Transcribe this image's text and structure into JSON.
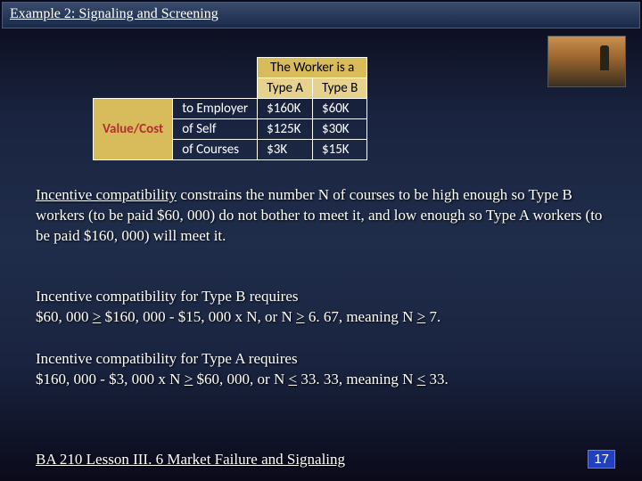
{
  "title": "Example 2: Signaling and Screening",
  "table": {
    "header_main": "The Worker is a",
    "col_a": "Type A",
    "col_b": "Type B",
    "rowgroup": "Value/Cost",
    "rows": [
      {
        "label": "to Employer",
        "a": "$160K",
        "b": "$60K"
      },
      {
        "label": "of Self",
        "a": "$125K",
        "b": "$30K"
      },
      {
        "label": "of Courses",
        "a": "$3K",
        "b": "$15K"
      }
    ]
  },
  "para1_lead": "Incentive compatibility",
  "para1_rest": " constrains the number N of courses to be high enough so Type B workers (to be paid $60, 000) do not bother to meet it, and low enough so Type A workers (to be paid $160, 000) will meet it.",
  "para2_l1": "Incentive compatibility for Type B requires",
  "para2_l2a": "$60, 000 ",
  "para2_l2b": ">",
  "para2_l2c": " $160, 000 - $15, 000 x N, or N ",
  "para2_l2d": ">",
  "para2_l2e": " 6. 67, meaning N ",
  "para2_l2f": ">",
  "para2_l2g": " 7.",
  "para3_l1": "Incentive compatibility for Type A requires",
  "para3_l2a": "$160, 000 - $3, 000 x N ",
  "para3_l2b": ">",
  "para3_l2c": " $60, 000, or N ",
  "para3_l2d": "<",
  "para3_l2e": " 33. 33, meaning N ",
  "para3_l2f": "<",
  "para3_l2g": " 33.",
  "footer": "BA 210  Lesson III. 6 Market Failure and Signaling",
  "page": "17",
  "chart_data": {
    "type": "table",
    "title": "The Worker is a",
    "columns": [
      "Type A",
      "Type B"
    ],
    "row_group": "Value/Cost",
    "rows": [
      {
        "label": "to Employer",
        "Type A": 160000,
        "Type B": 60000
      },
      {
        "label": "of Self",
        "Type A": 125000,
        "Type B": 30000
      },
      {
        "label": "of Courses",
        "Type A": 3000,
        "Type B": 15000
      }
    ],
    "units": "USD"
  }
}
